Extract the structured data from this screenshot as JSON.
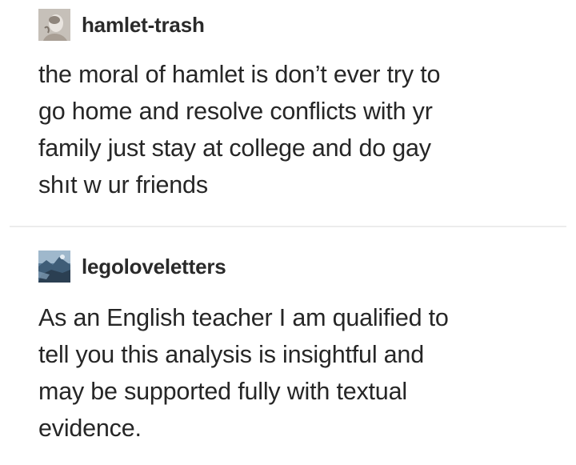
{
  "posts": [
    {
      "username": "hamlet-trash",
      "avatar_icon": "user-avatar-photo-icon",
      "body_lines": [
        "the moral of hamlet is don’t ever try to",
        "go home and resolve conflicts with yr",
        "family just stay at college and do gay",
        "shıt w ur friends"
      ]
    },
    {
      "username": "legoloveletters",
      "avatar_icon": "user-avatar-image-icon",
      "body_lines": [
        "As an English teacher I am qualified to",
        "tell you this analysis is insightful and",
        "may be supported fully with textual",
        "evidence."
      ]
    }
  ],
  "colors": {
    "text": "#262626",
    "username": "#2a2a2a",
    "divider": "#ececec",
    "background": "#ffffff"
  }
}
